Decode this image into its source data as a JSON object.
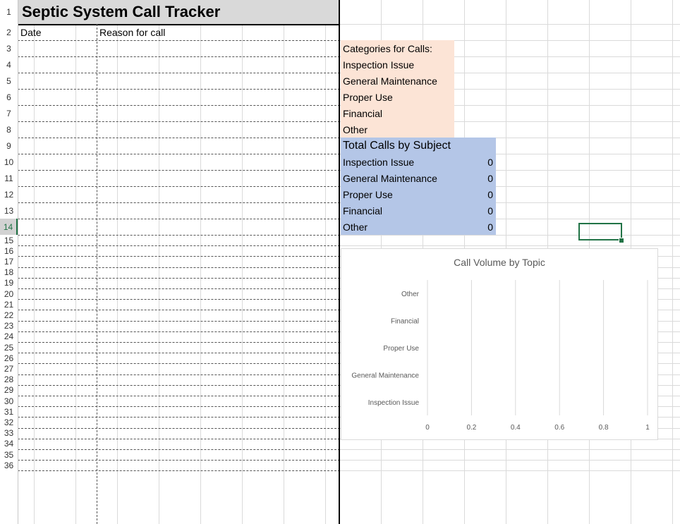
{
  "sheet": {
    "title": "Septic System Call Tracker",
    "headers": {
      "date": "Date",
      "reason": "Reason for call"
    },
    "row_numbers": [
      "1",
      "2",
      "3",
      "4",
      "5",
      "6",
      "7",
      "8",
      "9",
      "10",
      "11",
      "12",
      "13",
      "14",
      "15",
      "16",
      "17",
      "18",
      "19",
      "20",
      "21",
      "22",
      "23",
      "24",
      "25",
      "26",
      "27",
      "28",
      "29",
      "30",
      "31",
      "32",
      "33",
      "34",
      "35",
      "36"
    ],
    "active_row": "14",
    "categories": {
      "header": "Categories for Calls:",
      "items": [
        "Inspection Issue",
        "General Maintenance",
        "Proper Use",
        "Financial",
        "Other"
      ]
    },
    "totals": {
      "header": "Total Calls by Subject",
      "rows": [
        {
          "label": "Inspection Issue",
          "value": "0"
        },
        {
          "label": "General Maintenance",
          "value": "0"
        },
        {
          "label": "Proper Use",
          "value": "0"
        },
        {
          "label": "Financial",
          "value": "0"
        },
        {
          "label": "Other",
          "value": "0"
        }
      ]
    },
    "colors": {
      "peach": "#fce4d6",
      "blue": "#b4c6e7",
      "selection": "#217346"
    }
  },
  "chart_data": {
    "type": "bar",
    "orientation": "horizontal",
    "title": "Call Volume by Topic",
    "categories": [
      "Inspection Issue",
      "General Maintenance",
      "Proper Use",
      "Financial",
      "Other"
    ],
    "values": [
      0,
      0,
      0,
      0,
      0
    ],
    "xlim": [
      0,
      1
    ],
    "xticks": [
      "0",
      "0.2",
      "0.4",
      "0.6",
      "0.8",
      "1"
    ],
    "grid": true,
    "legend": "none"
  }
}
